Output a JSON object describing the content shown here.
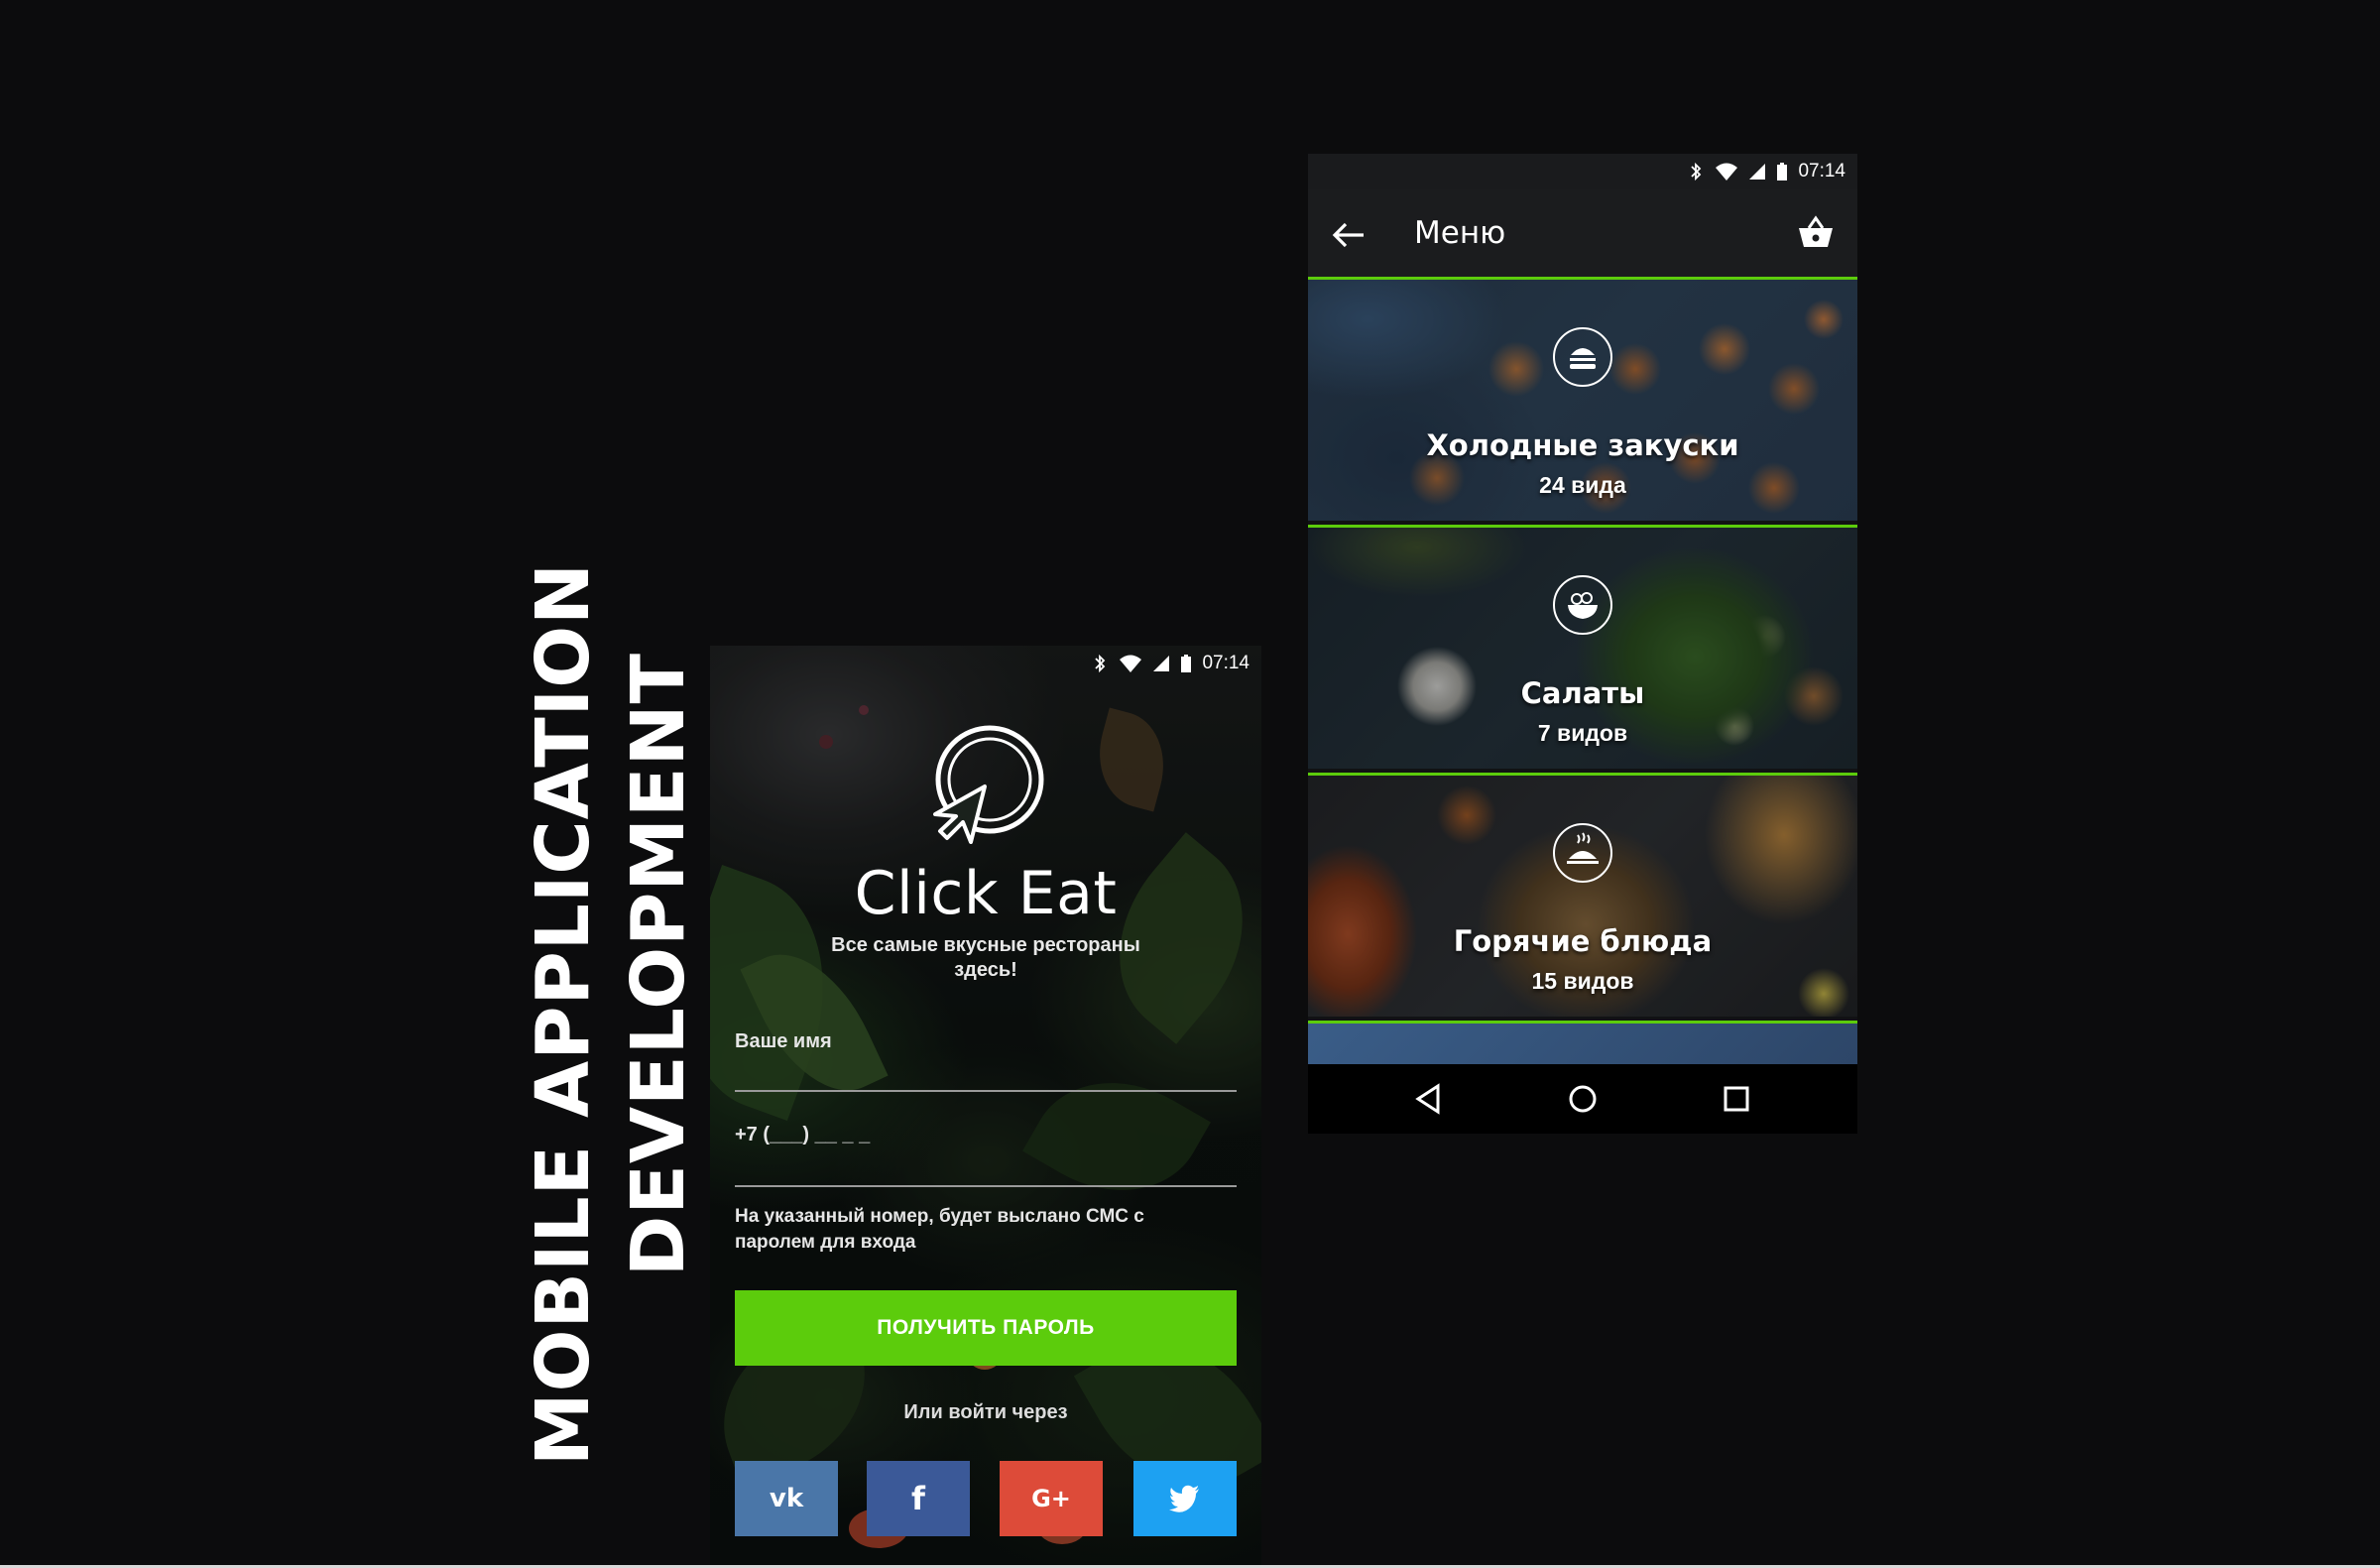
{
  "headline": {
    "line1": "MOBILE APPLICATION",
    "line2": "DEVELOPMENT"
  },
  "colors": {
    "accent": "#5ccc0c",
    "vk": "#4a76a8",
    "facebook": "#3b5998",
    "google": "#dd4b39",
    "twitter": "#1da1f2"
  },
  "login": {
    "status_time": "07:14",
    "app_name": "Click Eat",
    "tagline": "Все самые вкусные рестораны здесь!",
    "name_label": "Ваше имя",
    "phone_placeholder": "+7 (___) __ _ _",
    "sms_note": "На указанный номер, будет выслано СМС с паролем для входа",
    "get_password_button": "ПОЛУЧИТЬ ПАРОЛЬ",
    "or_login_via": "Или войти через",
    "social": [
      {
        "name": "vk",
        "icon": "vk-icon",
        "glyph": "vk"
      },
      {
        "name": "facebook",
        "icon": "facebook-icon",
        "glyph": "f"
      },
      {
        "name": "google-plus",
        "icon": "google-plus-icon",
        "glyph": "G+"
      },
      {
        "name": "twitter",
        "icon": "twitter-icon",
        "glyph": ""
      }
    ]
  },
  "menu": {
    "status_time": "07:14",
    "title": "Меню",
    "categories": [
      {
        "name": "Холодные закуски",
        "count": "24 вида",
        "icon": "burger-icon"
      },
      {
        "name": "Салаты",
        "count": "7 видов",
        "icon": "salad-bowl-icon"
      },
      {
        "name": "Горячие блюда",
        "count": "15 видов",
        "icon": "hot-dish-icon"
      }
    ]
  }
}
